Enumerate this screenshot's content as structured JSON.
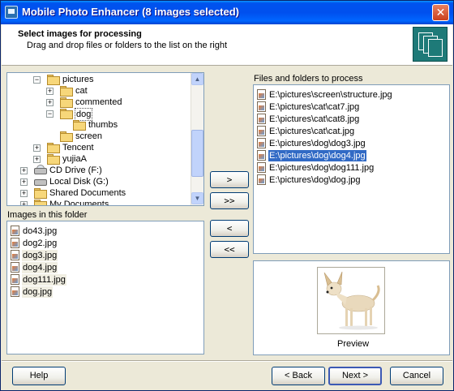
{
  "window": {
    "title": "Mobile Photo Enhancer (8 images selected)",
    "close_glyph": "✕",
    "app_icon": "app-icon"
  },
  "header": {
    "title": "Select images for processing",
    "subtitle": "Drag and drop files or folders to the list on the right",
    "logo_icon": "stacked-photos-icon"
  },
  "tree": {
    "items": [
      {
        "label": "pictures",
        "expander": "−",
        "icon": "folder-icon"
      },
      {
        "label": "cat",
        "expander": "+",
        "icon": "folder-icon"
      },
      {
        "label": "commented",
        "expander": "+",
        "icon": "folder-icon"
      },
      {
        "label": "dog",
        "expander": "−",
        "icon": "folder-icon",
        "selected": true
      },
      {
        "label": "thumbs",
        "expander": "",
        "icon": "folder-icon"
      },
      {
        "label": "screen",
        "expander": "",
        "icon": "folder-icon"
      },
      {
        "label": "Tencent",
        "expander": "+",
        "icon": "folder-icon"
      },
      {
        "label": "yujiaA",
        "expander": "+",
        "icon": "folder-icon"
      },
      {
        "label": "CD Drive (F:)",
        "expander": "+",
        "icon": "cd-drive-icon"
      },
      {
        "label": "Local Disk (G:)",
        "expander": "+",
        "icon": "hard-drive-icon"
      },
      {
        "label": "Shared Documents",
        "expander": "+",
        "icon": "folder-icon"
      },
      {
        "label": "My Documents",
        "expander": "+",
        "icon": "folder-icon"
      }
    ]
  },
  "images_in_folder": {
    "label": "Images in this folder",
    "items": [
      "do43.jpg",
      "dog2.jpg",
      "dog3.jpg",
      "dog4.jpg",
      "dog111.jpg",
      "dog.jpg"
    ]
  },
  "transfer_buttons": {
    "add": ">",
    "add_all": ">>",
    "remove": "<",
    "remove_all": "<<"
  },
  "files_to_process": {
    "label": "Files and folders to process",
    "items": [
      "E:\\pictures\\screen\\structure.jpg",
      "E:\\pictures\\cat\\cat7.jpg",
      "E:\\pictures\\cat\\cat8.jpg",
      "E:\\pictures\\cat\\cat.jpg",
      "E:\\pictures\\dog\\dog3.jpg",
      "E:\\pictures\\dog\\dog4.jpg",
      "E:\\pictures\\dog\\dog111.jpg",
      "E:\\pictures\\dog\\dog.jpg"
    ],
    "selected_index": 5
  },
  "preview": {
    "label": "Preview",
    "image": "chihuahua-dog-photo"
  },
  "footer": {
    "help": "Help",
    "back": "< Back",
    "next": "Next >",
    "cancel": "Cancel"
  },
  "colors": {
    "titlebar": "#0053EE",
    "selection": "#316AC5",
    "dialog_bg": "#ECE9D8",
    "logo_bg": "#1E7A78"
  }
}
